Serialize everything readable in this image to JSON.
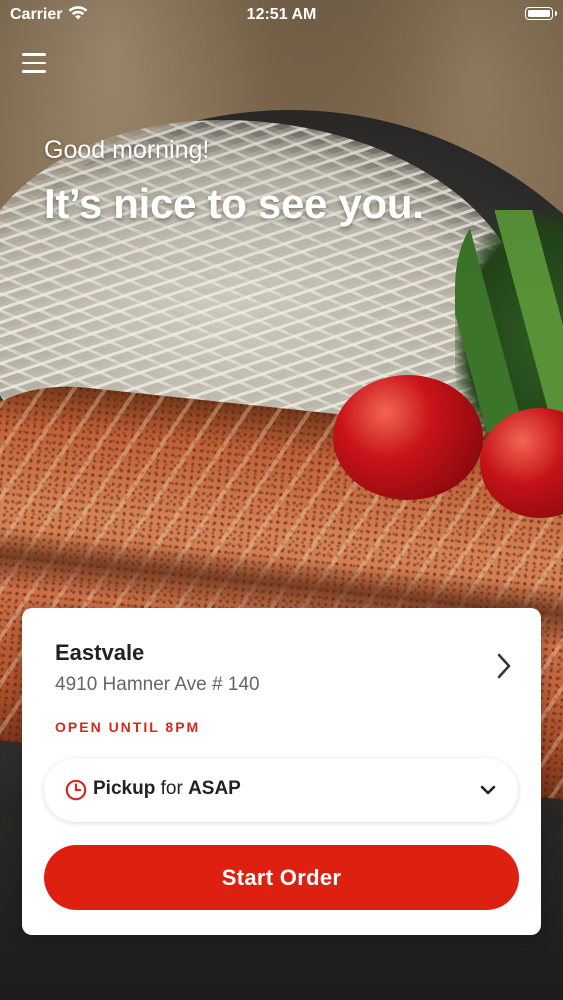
{
  "status_bar": {
    "carrier": "Carrier",
    "time": "12:51 AM",
    "wifi_icon": "wifi-icon",
    "battery_icon": "battery-icon"
  },
  "header": {
    "menu_icon": "hamburger-menu-icon",
    "greeting": "Good morning!",
    "headline": "It’s nice to see you."
  },
  "location": {
    "name": "Eastvale",
    "address": "4910 Hamner Ave # 140",
    "hours": "OPEN UNTIL 8PM",
    "chevron_icon": "chevron-right-icon"
  },
  "order_mode": {
    "clock_icon": "clock-icon",
    "mode": "Pickup",
    "connector": "for",
    "time": "ASAP",
    "dropdown_icon": "chevron-down-icon"
  },
  "actions": {
    "start_order": "Start Order"
  },
  "colors": {
    "accent": "#dd2010",
    "hours_text": "#d42a1e",
    "card_bg": "#ffffff"
  }
}
